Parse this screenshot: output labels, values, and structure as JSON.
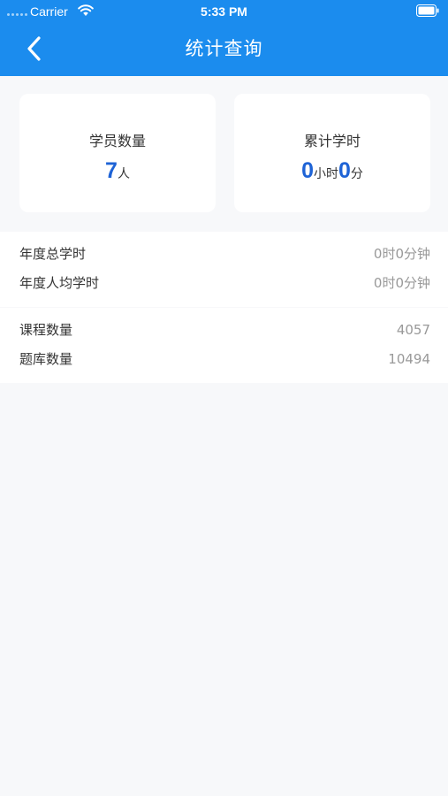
{
  "status_bar": {
    "carrier": "Carrier",
    "time": "5:33 PM"
  },
  "header": {
    "title": "统计查询",
    "back_icon": "chevron-left-icon"
  },
  "cards": [
    {
      "label": "学员数量",
      "value": "7",
      "unit": "人"
    },
    {
      "label": "累计学时",
      "hours": "0",
      "hours_unit": "小时",
      "minutes": "0",
      "minutes_unit": "分"
    }
  ],
  "annual": {
    "rows": [
      {
        "label": "年度总学时",
        "value": "0时0分钟"
      },
      {
        "label": "年度人均学时",
        "value": "0时0分钟"
      }
    ]
  },
  "library": {
    "rows": [
      {
        "label": "课程数量",
        "value": "4057"
      },
      {
        "label": "题库数量",
        "value": "10494"
      }
    ]
  },
  "colors": {
    "header_bg": "#1b8cee",
    "accent_number": "#1e63d6",
    "page_bg": "#f7f8fa"
  }
}
